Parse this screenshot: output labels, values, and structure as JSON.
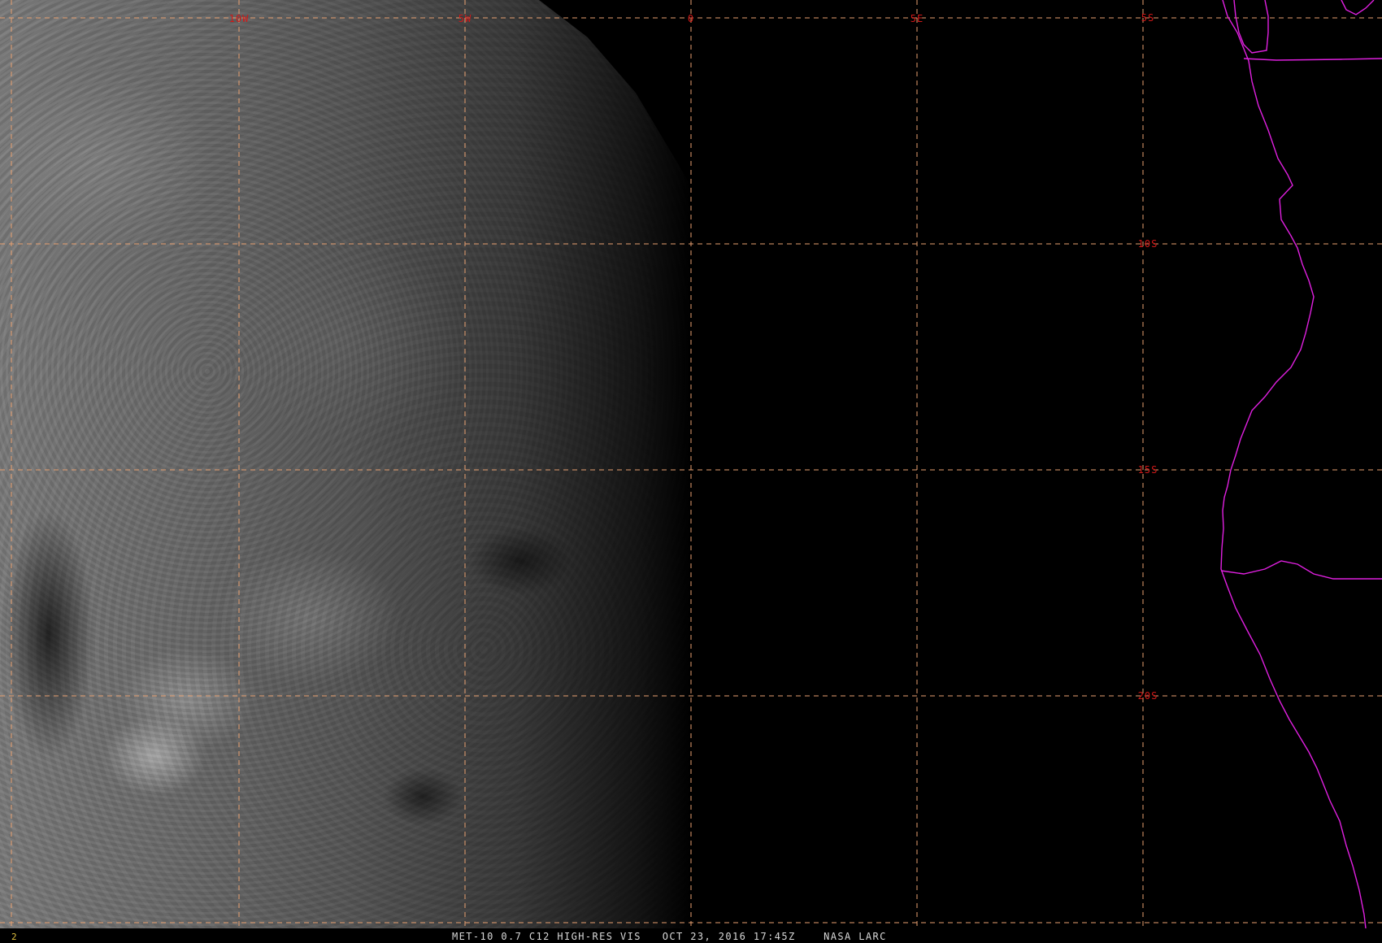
{
  "map": {
    "grid_color": "#e8a070",
    "coastline_color": "#e020e0",
    "label_color": "#d01818",
    "longitude_labels": [
      {
        "text": "10W",
        "lon": -10
      },
      {
        "text": "5W",
        "lon": -5
      },
      {
        "text": "0",
        "lon": 0
      },
      {
        "text": "5E",
        "lon": 5
      }
    ],
    "latitude_labels": [
      {
        "text": "5S",
        "lat": -5
      },
      {
        "text": "10S",
        "lat": -10
      },
      {
        "text": "15S",
        "lat": -15
      },
      {
        "text": "20S",
        "lat": -20
      }
    ]
  },
  "status": {
    "frame_number": "2",
    "caption": "MET-10 0.7 C12 HIGH-RES VIS   OCT 23, 2016 17:45Z    NASA LARC"
  }
}
